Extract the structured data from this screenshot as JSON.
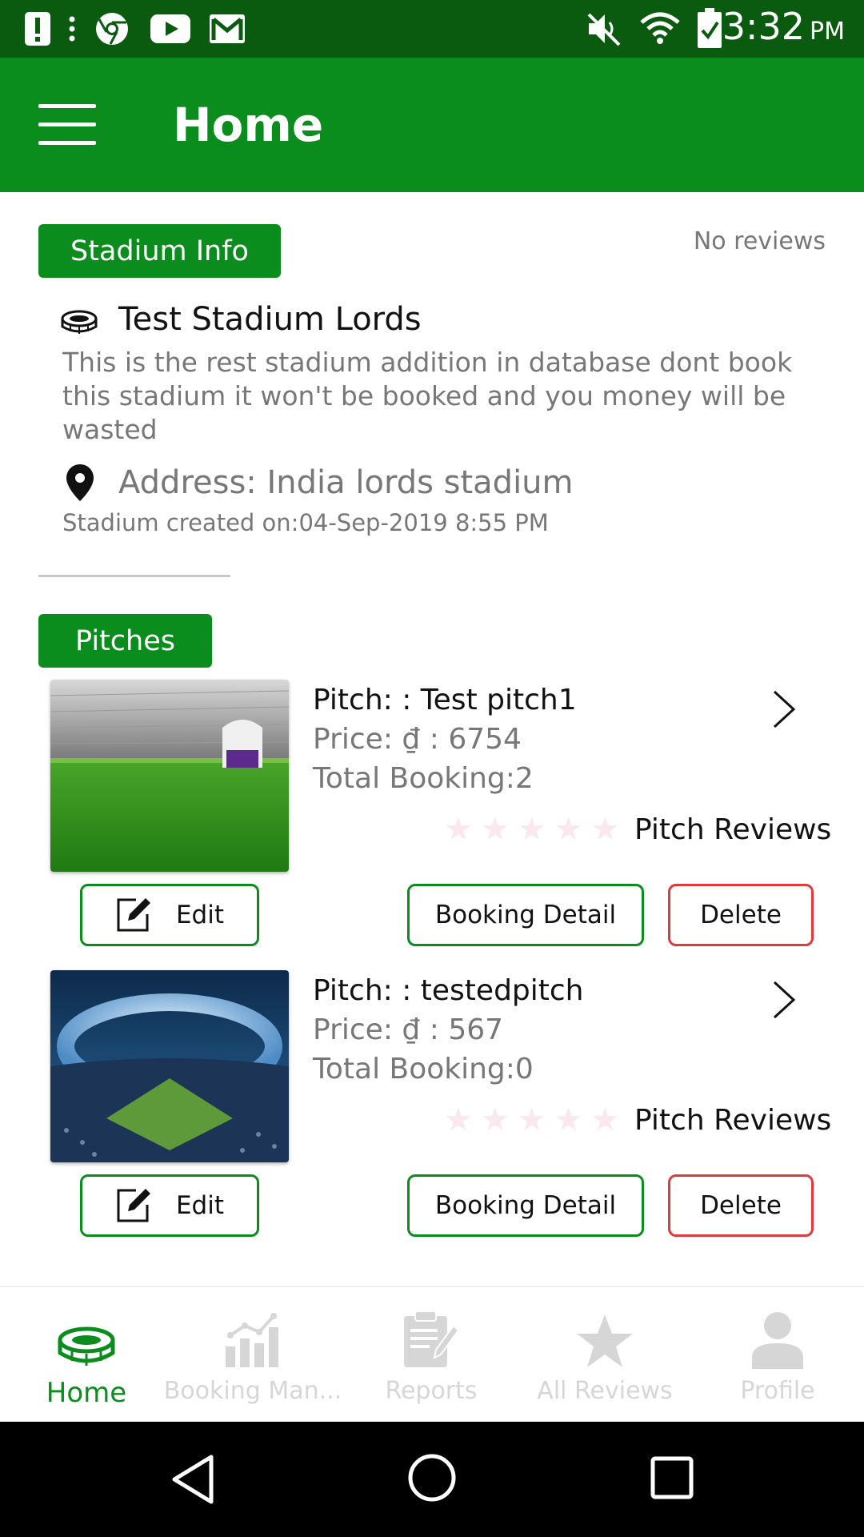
{
  "status_bar": {
    "time": "3:32",
    "ampm": "PM"
  },
  "app_bar": {
    "title": "Home"
  },
  "stadium": {
    "tag": "Stadium Info",
    "reviews_status": "No reviews",
    "name": "Test Stadium Lords",
    "description": "This is the rest stadium addition in database dont book this stadium it won't be booked and you money will be wasted",
    "address": "Address: India lords stadium",
    "created": "Stadium created on:04-Sep-2019 8:55 PM"
  },
  "pitches": {
    "tag": "Pitches",
    "items": [
      {
        "name": "Pitch: : Test pitch1",
        "price": "Price: ₫ : 6754",
        "total_booking": "Total Booking:2",
        "rating": 0,
        "reviews_label": "Pitch Reviews",
        "edit_label": "Edit",
        "booking_label": "Booking Detail",
        "delete_label": "Delete"
      },
      {
        "name": "Pitch: : testedpitch",
        "price": "Price: ₫ : 567",
        "total_booking": "Total Booking:0",
        "rating": 0,
        "reviews_label": "Pitch Reviews",
        "edit_label": "Edit",
        "booking_label": "Booking Detail",
        "delete_label": "Delete"
      }
    ]
  },
  "bottom_nav": {
    "items": [
      {
        "label": "Home",
        "icon": "stadium-icon",
        "active": true
      },
      {
        "label": "Booking Man...",
        "icon": "chart-icon",
        "active": false
      },
      {
        "label": "Reports",
        "icon": "clipboard-icon",
        "active": false
      },
      {
        "label": "All Reviews",
        "icon": "star-icon",
        "active": false
      },
      {
        "label": "Profile",
        "icon": "person-icon",
        "active": false
      }
    ]
  },
  "colors": {
    "status_bar": "#0a5a0f",
    "primary": "#0b8d1d",
    "danger": "#e03a3a",
    "muted_text": "#777777"
  }
}
